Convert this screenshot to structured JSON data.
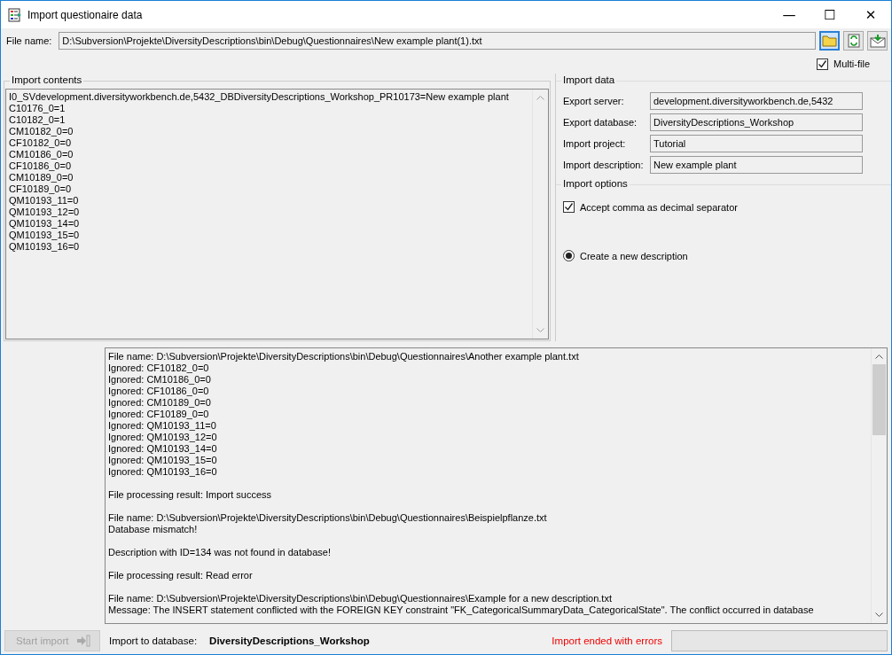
{
  "window": {
    "title": "Import questionaire data",
    "controls": [
      "—",
      "☐",
      "✕"
    ]
  },
  "file": {
    "label": "File name:",
    "value": "D:\\Subversion\\Projekte\\DiversityDescriptions\\bin\\Debug\\Questionnaires\\New example plant(1).txt",
    "multi_file": {
      "label": "Multi-file",
      "checked": true
    }
  },
  "import_contents": {
    "title": "Import contents",
    "lines": [
      "I0_SVdevelopment.diversityworkbench.de,5432_DBDiversityDescriptions_Workshop_PR10173=New example plant",
      "C10176_0=1",
      "C10182_0=1",
      "CM10182_0=0",
      "CF10182_0=0",
      "CM10186_0=0",
      "CF10186_0=0",
      "CM10189_0=0",
      "CF10189_0=0",
      "QM10193_11=0",
      "QM10193_12=0",
      "QM10193_14=0",
      "QM10193_15=0",
      "QM10193_16=0"
    ]
  },
  "import_data": {
    "title": "Import data",
    "fields": [
      {
        "label": "Export server:",
        "value": "development.diversityworkbench.de,5432"
      },
      {
        "label": "Export database:",
        "value": "DiversityDescriptions_Workshop"
      },
      {
        "label": "Import project:",
        "value": "Tutorial"
      },
      {
        "label": "Import description:",
        "value": "New example plant"
      }
    ]
  },
  "import_options": {
    "title": "Import options",
    "options": [
      {
        "kind": "checkbox",
        "label": "Accept comma as decimal separator",
        "checked": true
      },
      {
        "kind": "radio",
        "label": "Create a new description",
        "selected": true
      }
    ]
  },
  "log": {
    "blocks": [
      [
        "File name: D:\\Subversion\\Projekte\\DiversityDescriptions\\bin\\Debug\\Questionnaires\\Another example plant.txt",
        "Ignored: CF10182_0=0",
        "Ignored: CM10186_0=0",
        "Ignored: CF10186_0=0",
        "Ignored: CM10189_0=0",
        "Ignored: CF10189_0=0",
        "Ignored: QM10193_11=0",
        "Ignored: QM10193_12=0",
        "Ignored: QM10193_14=0",
        "Ignored: QM10193_15=0",
        "Ignored: QM10193_16=0"
      ],
      [
        "File processing result: Import success"
      ],
      [
        "File name: D:\\Subversion\\Projekte\\DiversityDescriptions\\bin\\Debug\\Questionnaires\\Beispielpflanze.txt",
        "Database mismatch!"
      ],
      [
        "Description with ID=134 was not found in database!"
      ],
      [
        "File processing result: Read error"
      ],
      [
        "File name: D:\\Subversion\\Projekte\\DiversityDescriptions\\bin\\Debug\\Questionnaires\\Example for a new description.txt",
        "Message: The INSERT statement conflicted with the FOREIGN KEY constraint \"FK_CategoricalSummaryData_CategoricalState\". The conflict occurred in database"
      ]
    ]
  },
  "footer": {
    "start_button": {
      "label": "Start import",
      "disabled": true
    },
    "target_label": "Import to database:",
    "target_value": "DiversityDescriptions_Workshop",
    "status": "Import ended with errors"
  }
}
